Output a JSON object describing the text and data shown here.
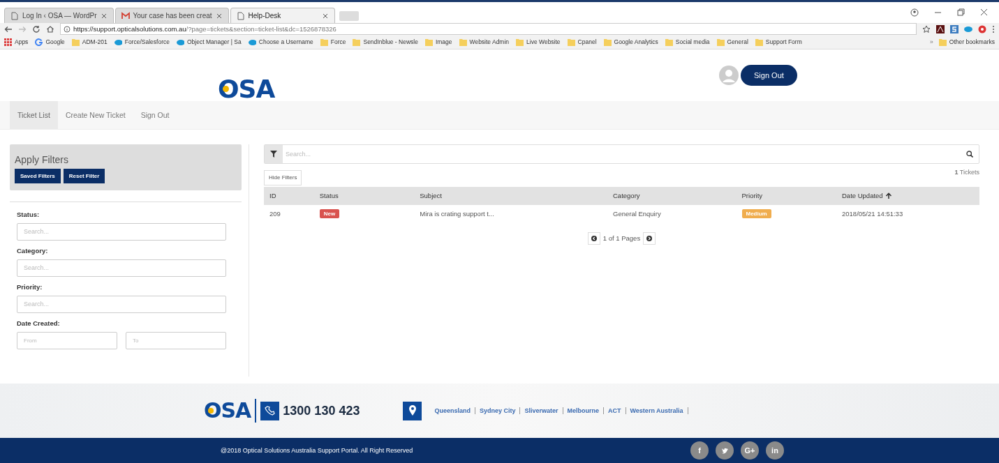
{
  "browser": {
    "tabs": [
      {
        "title": "Log In ‹ OSA — WordPr",
        "kind": "page",
        "selected": false
      },
      {
        "title": "Your case has been creat",
        "kind": "mail",
        "selected": false
      },
      {
        "title": "Help-Desk",
        "kind": "page",
        "selected": true
      }
    ],
    "address": {
      "host": "https://support.opticalsolutions.com.au",
      "rest": "/?page=tickets&section=ticket-list&dc=1526878326"
    },
    "bookmarks": [
      {
        "label": "Apps",
        "kind": "apps"
      },
      {
        "label": "Google",
        "kind": "google"
      },
      {
        "label": "ADM-201",
        "kind": "folder"
      },
      {
        "label": "Force/Salesforce",
        "kind": "cloud"
      },
      {
        "label": "Object Manager | Sa",
        "kind": "cloud"
      },
      {
        "label": "Choose a Username",
        "kind": "cloud"
      },
      {
        "label": "Force",
        "kind": "folder"
      },
      {
        "label": "SendInblue - Newsle",
        "kind": "folder"
      },
      {
        "label": "Image",
        "kind": "folder"
      },
      {
        "label": "Website Admin",
        "kind": "folder"
      },
      {
        "label": "Live Website",
        "kind": "folder"
      },
      {
        "label": "Cpanel",
        "kind": "folder"
      },
      {
        "label": "Google Analytics",
        "kind": "folder"
      },
      {
        "label": "Social media",
        "kind": "folder"
      },
      {
        "label": "General",
        "kind": "folder"
      },
      {
        "label": "Support Form",
        "kind": "folder"
      }
    ],
    "more_bookmarks": "»",
    "other_bookmarks": "Other bookmarks"
  },
  "header": {
    "logo": "OSA",
    "sign_out": "Sign Out"
  },
  "nav": [
    {
      "label": "Ticket List",
      "selected": true
    },
    {
      "label": "Create New Ticket",
      "selected": false
    },
    {
      "label": "Sign Out",
      "selected": false
    }
  ],
  "filters": {
    "title": "Apply Filters",
    "buttons": [
      "Saved Filters",
      "Reset Filter"
    ],
    "fields": [
      {
        "label": "Status:",
        "placeholder": "Search..."
      },
      {
        "label": "Category:",
        "placeholder": "Search..."
      },
      {
        "label": "Priority:",
        "placeholder": "Search..."
      }
    ],
    "date": {
      "label": "Date Created:",
      "from": {
        "placeholder": "From"
      },
      "to": {
        "placeholder": "To"
      }
    }
  },
  "tickets": {
    "search_placeholder": "Search...",
    "hide_filters": "Hide Filters",
    "count": "1",
    "count_label": "Tickets",
    "columns": [
      "ID",
      "Status",
      "Subject",
      "Category",
      "Priority",
      "Date Updated"
    ],
    "rows": [
      {
        "id": "209",
        "status": {
          "label": "New",
          "color": "#d9534f"
        },
        "subject": "Mira is crating support t...",
        "category": "General Enquiry",
        "priority": {
          "label": "Medium",
          "color": "#f0ad4e"
        },
        "date": "2018/05/21 14:51:33"
      }
    ],
    "pager": {
      "current": "1",
      "of": "of",
      "total": "1",
      "pages": "Pages"
    }
  },
  "footer": {
    "logo": "OSA",
    "phone": "1300 130 423",
    "locations": [
      "Queensland",
      "Sydney City",
      "Sliverwater",
      "Melbourne",
      "ACT",
      "Western Australia"
    ],
    "copyright": "@2018 Optical Solutions Australia Support Portal. All Right Reserved",
    "social": [
      {
        "kind": "text",
        "label": "f"
      },
      {
        "kind": "twitter"
      },
      {
        "kind": "text",
        "label": "G+"
      },
      {
        "kind": "text",
        "label": "in"
      }
    ]
  }
}
